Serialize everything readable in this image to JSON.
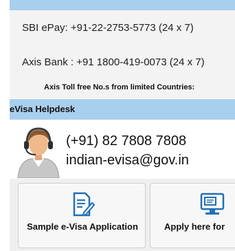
{
  "contacts": {
    "sbi_epay": "SBI ePay: +91-22-2753-5773 (24 x 7)",
    "axis_bank": "Axis Bank : +91 1800-419-0073 (24 x 7)",
    "axis_toll_free": "Axis Toll free No.s from limited Countries:"
  },
  "helpdesk": {
    "title": "eVisa Helpdesk",
    "phone": "(+91) 82 7808 7808",
    "email": "indian-evisa@gov.in",
    "avatar_icon": "support-agent-icon"
  },
  "tiles": [
    {
      "label": "Sample e-Visa Application",
      "icon": "document-edit-icon"
    },
    {
      "label": "Apply here for",
      "icon": "computer-screen-icon"
    }
  ],
  "colors": {
    "accent": "#a9cfee",
    "icon_blue": "#1f6fb8"
  }
}
